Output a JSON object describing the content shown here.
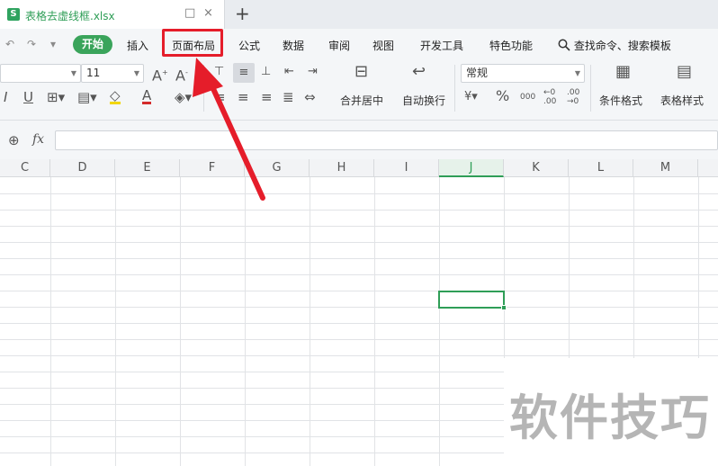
{
  "tab": {
    "doc_icon": "S",
    "title": "表格去虚线框.xlsx",
    "pin_icon": "□",
    "close_icon": "×",
    "add_icon": "+"
  },
  "menu": {
    "undo_icon": "↶",
    "redo_icon": "↷",
    "more_icon": "▾",
    "items": [
      "开始",
      "插入",
      "页面布局",
      "公式",
      "数据",
      "审阅",
      "视图",
      "开发工具",
      "特色功能"
    ],
    "search_label": "查找命令、搜索模板",
    "highlighted": "页面布局"
  },
  "ribbon": {
    "font_name": "",
    "font_size": "11",
    "number_format": "常规",
    "merge_label": "合并居中",
    "wrap_label": "自动换行",
    "cond_format_label": "条件格式",
    "table_style_label": "表格样式",
    "currency_icon": "¥",
    "percent_icon": "%",
    "thousands_icon": "000",
    "inc_decimal_icon": "←0 .00",
    "dec_decimal_icon": ".00 →0"
  },
  "formula": {
    "zoom_icon": "⊕",
    "fx_label": "fx",
    "value": ""
  },
  "columns": [
    "C",
    "D",
    "E",
    "F",
    "G",
    "H",
    "I",
    "J",
    "K",
    "L",
    "M"
  ],
  "selected_column": "J",
  "watermark": "软件技巧",
  "colors": {
    "accent": "#2f9e57",
    "highlight": "#e51d2a"
  }
}
